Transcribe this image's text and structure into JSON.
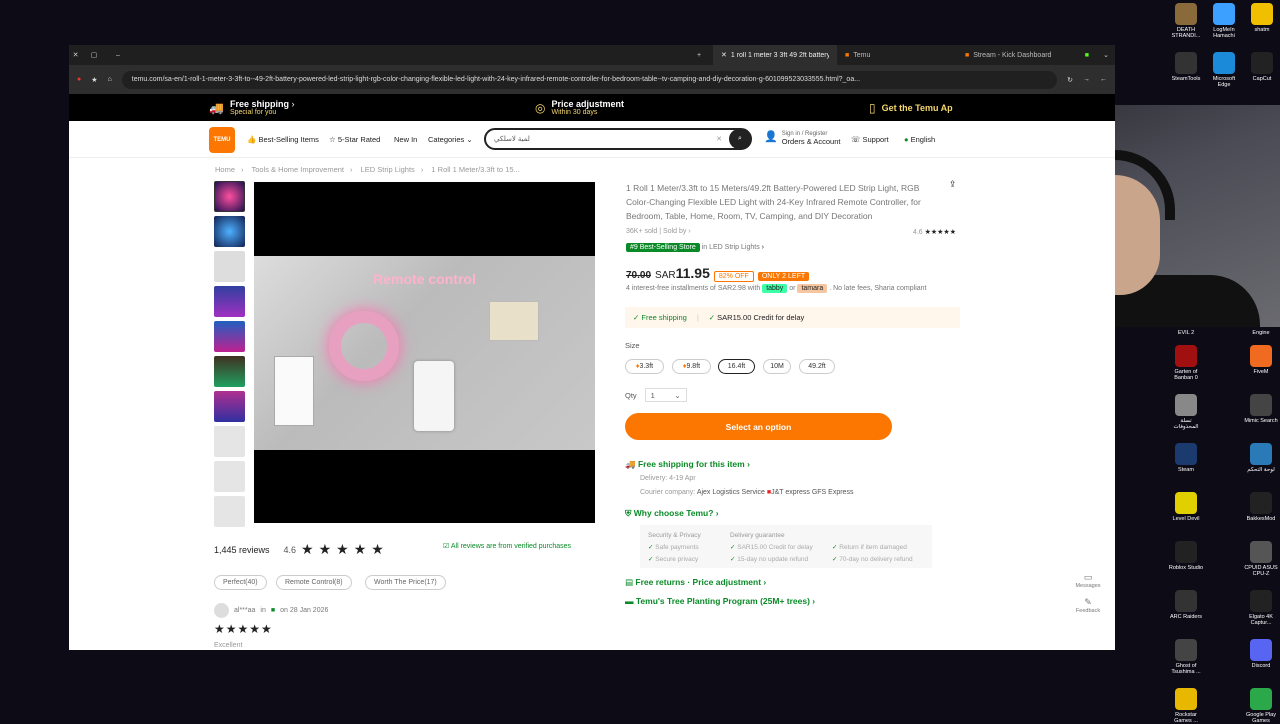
{
  "desktop": {
    "icons_top": [
      {
        "label": "DEATH STRANDI...",
        "color": "#8a6a3a"
      },
      {
        "label": "LogMeIn Hamachi",
        "color": "#3ba0ff"
      },
      {
        "label": "shatm",
        "color": "#f0c000"
      },
      {
        "label": "SteamTools",
        "color": "#333"
      },
      {
        "label": "Microsoft Edge",
        "color": "#1b8ad8"
      },
      {
        "label": "CapCut",
        "color": "#222"
      }
    ],
    "icons_mid": [
      {
        "label": "Garten of Banban 0",
        "color": "#a01010"
      },
      {
        "label": "FiveM",
        "color": "#f06a20"
      },
      {
        "label": "تسلة المحذوفات",
        "color": "#888"
      },
      {
        "label": "Mimic Search",
        "color": "#444"
      },
      {
        "label": "Steam",
        "color": "#1b3b6f"
      },
      {
        "label": "لوحة التحكم",
        "color": "#2a7ab8"
      },
      {
        "label": "Level Devil",
        "color": "#e0d000"
      },
      {
        "label": "BakkesMod",
        "color": "#222"
      },
      {
        "label": "Roblox Studio",
        "color": "#222"
      },
      {
        "label": "CPUID ASUS CPU-Z",
        "color": "#555"
      },
      {
        "label": "ARC Raiders",
        "color": "#333"
      },
      {
        "label": "Elgato 4K Captur...",
        "color": "#222"
      },
      {
        "label": "Ghost of Tsushima ...",
        "color": "#444"
      },
      {
        "label": "Discord",
        "color": "#5865f2"
      },
      {
        "label": "Rockstar Games ...",
        "color": "#e8b800"
      },
      {
        "label": "Google Play Games",
        "color": "#2aa84a"
      }
    ],
    "icons_partial": [
      {
        "label": "EVIL 2"
      },
      {
        "label": "Engine"
      }
    ]
  },
  "browser": {
    "tabs": [
      {
        "label": "1 roll 1 meter 3 3ft 49 2ft battery",
        "active": true
      },
      {
        "label": "Temu",
        "active": false
      },
      {
        "label": "Stream - Kick Dashboard",
        "active": false
      }
    ],
    "url": "temu.com/sa-en/1-roll-1-meter-3-3ft-to--49-2ft-battery-powered-led-strip-light-rgb-color-changing-flexible-led-light-with-24-key-infrared-remote-controller-for-bedroom-table--tv-camping-and-diy-decoration-g-601099523033555.html?_oa..."
  },
  "promo": {
    "free_shipping": "Free shipping",
    "free_shipping_sub": "Special for you",
    "price_adjust": "Price adjustment",
    "price_adjust_sub": "Within 30 days",
    "get_app": "Get the Temu Ap"
  },
  "header": {
    "logo": "TEMU",
    "nav": [
      "Best-Selling Items",
      "5-Star Rated",
      "New In",
      "Categories"
    ],
    "search_value": "لمبة لاسلكي",
    "sign_in": "Sign in / Register",
    "orders": "Orders & Account",
    "support": "Support",
    "language": "English"
  },
  "breadcrumb": [
    "Home",
    "Tools & Home Improvement",
    "LED Strip Lights",
    "1 Roll 1 Meter/3.3ft to 15..."
  ],
  "product": {
    "caption": "Remote control",
    "title": "1 Roll 1 Meter/3.3ft to 15 Meters/49.2ft Battery-Powered LED Strip Light, RGB Color-Changing Flexible LED Light with 24-Key Infrared Remote Controller, for Bedroom, Table, Home, Room, TV, Camping, and DIY Decoration",
    "sold": "36K+ sold | Sold by",
    "rating_small": "4.6",
    "best_seller": "#9 Best-Selling Store",
    "best_seller_cat": "in LED Strip Lights",
    "old_price": "70.00",
    "currency": "SAR",
    "price": "11.95",
    "off": "82% OFF",
    "left": "ONLY 2 LEFT",
    "installments": "4 interest-free installments of SAR2.98 with",
    "tabby": "tabby",
    "or": "or",
    "tamara": "tamara",
    "no_fees": ". No late fees, Sharia compliant",
    "ship_free": "Free shipping",
    "credit": "SAR15.00 Credit for delay",
    "size_label": "Size",
    "sizes": [
      "3.3ft",
      "9.8ft",
      "16.4ft",
      "10M",
      "49.2ft"
    ],
    "qty_label": "Qty",
    "qty": "1",
    "select_btn": "Select an option",
    "free_ship_item": "Free shipping for this item",
    "delivery": "Delivery: 4-19 Apr",
    "courier": "Courier company:",
    "couriers": [
      "Ajex Logistics Service",
      "J&T express",
      "GFS Express"
    ],
    "why": "Why choose Temu?",
    "security": "Security & Privacy",
    "safe_pay": "Safe payments",
    "secure_priv": "Secure privacy",
    "guarantee": "Delivery guarantee",
    "g1": "SAR15.00 Credit for delay",
    "g2": "Return if item damaged",
    "g3": "15-day no update refund",
    "g4": "70-day no delivery refund",
    "returns": "Free returns · Price adjustment",
    "tree": "Temu's Tree Planting Program (25M+ trees)"
  },
  "reviews": {
    "count": "1,445 reviews",
    "rating": "4.6",
    "verified": "All reviews are from verified purchases",
    "chips": [
      "Perfect(40)",
      "Remote Control(8)",
      "Worth The Price(17)"
    ],
    "reviewer": "al***aa",
    "in": "in",
    "date": "on 28 Jan 2026",
    "text": "Excellent"
  },
  "side_tools": {
    "messages": "Messages",
    "feedback": "Feedback"
  },
  "colors": {
    "brand": "#fb7701",
    "green": "#0a8a27",
    "dark": "#222222"
  }
}
